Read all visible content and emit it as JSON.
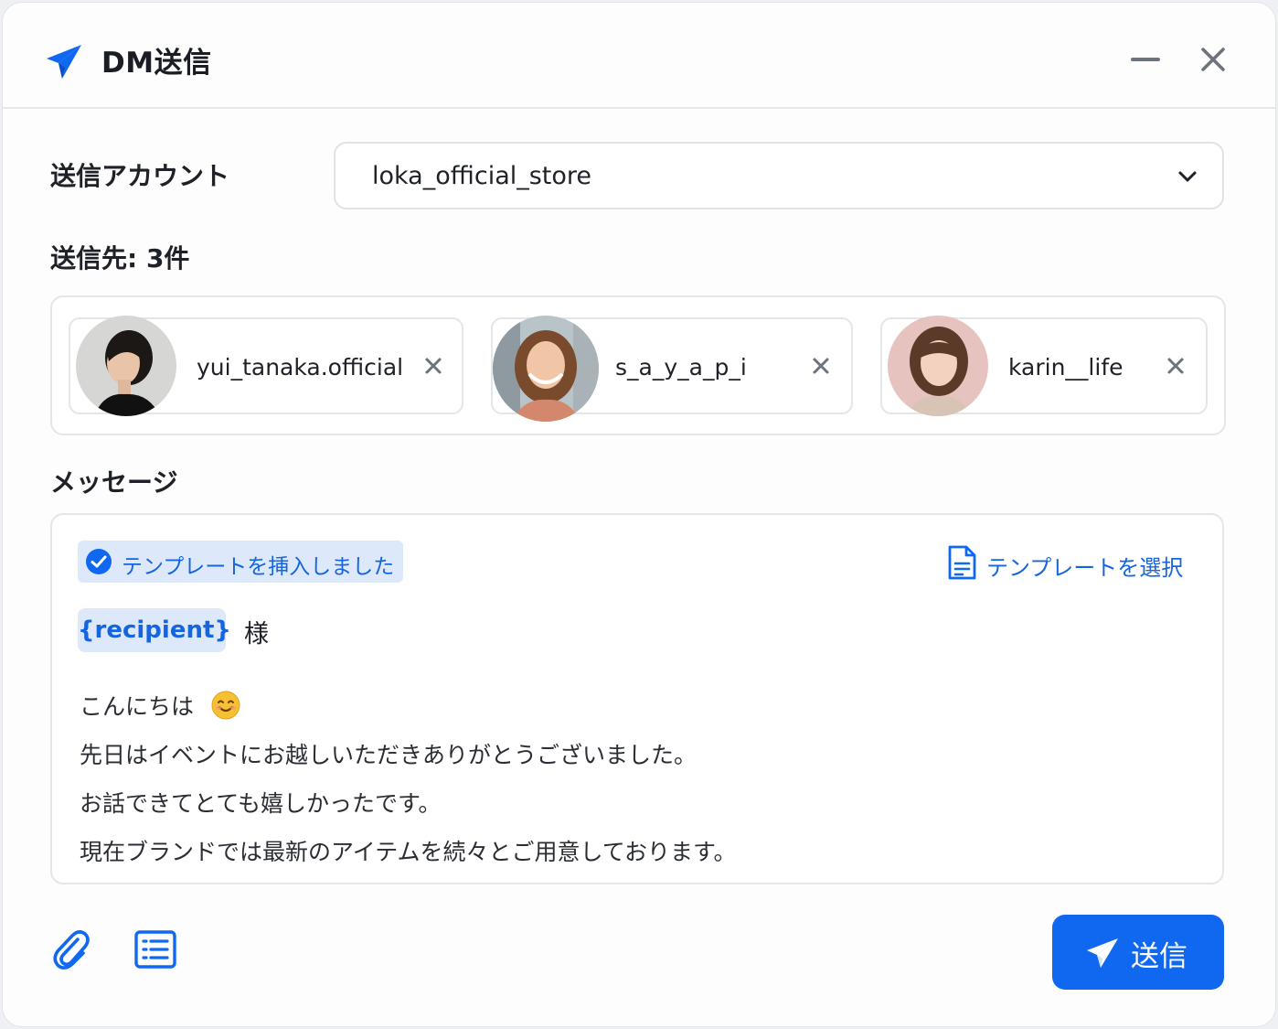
{
  "window": {
    "title": "DM送信",
    "title_icon": "paper-plane-icon",
    "controls": [
      "minimize-icon",
      "close-icon"
    ]
  },
  "account": {
    "label": "送信アカウント",
    "selected": "loka_official_store",
    "chevron_icon": "chevron-down-icon"
  },
  "recipients": {
    "label": "送信先: 3件",
    "items": [
      {
        "name": "yui_tanaka.official",
        "avatar": "avatar-photo",
        "remove_icon": "x-icon"
      },
      {
        "name": "s_a_y_a_p_i",
        "avatar": "avatar-photo",
        "remove_icon": "x-icon"
      },
      {
        "name": "karin__life",
        "avatar": "avatar-photo",
        "remove_icon": "x-icon"
      }
    ]
  },
  "message": {
    "label": "メッセージ",
    "inserted_notice": "テンプレートを挿入しました",
    "select_template": "テンプレートを選択",
    "variable_tag": "{recipient}",
    "honorific": "様",
    "lines": [
      "こんにちは",
      "先日はイベントにお越しいただきありがとうございました。",
      "お話できてとても嬉しかったです。",
      "現在ブランドでは最新のアイテムを続々とご用意しております。"
    ],
    "emoji": "smiling-face-emoji"
  },
  "footer": {
    "attach_icon": "paperclip-icon",
    "list_icon": "list-icon",
    "send_label": "送信"
  },
  "colors": {
    "accent": "#1168f0",
    "accent_light": "#dde9fb",
    "text": "#1e2128",
    "border": "#e3e6ea"
  }
}
